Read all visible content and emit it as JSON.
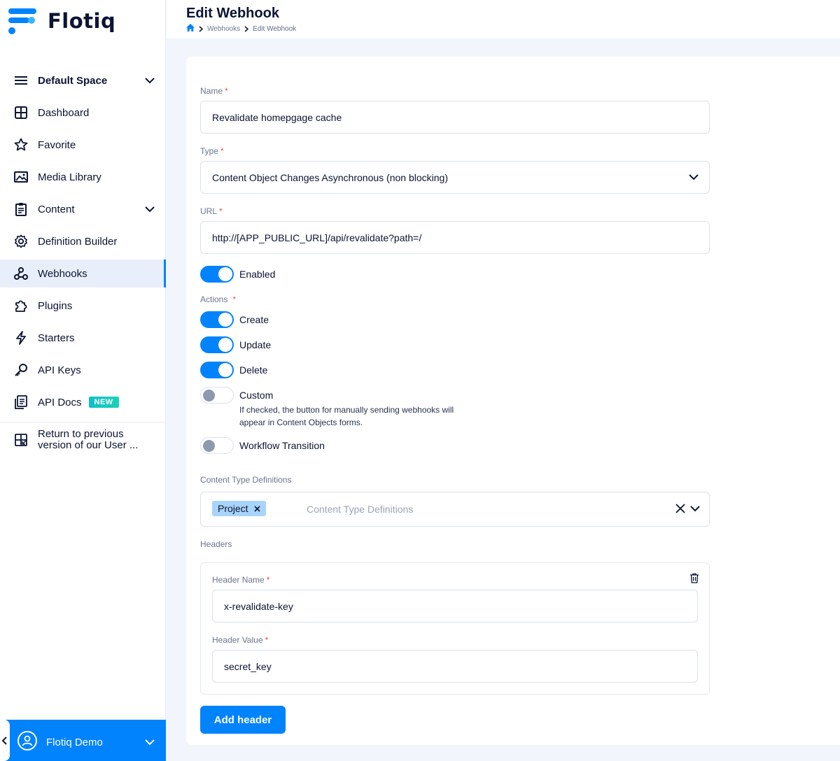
{
  "app": {
    "name": "Flotiq"
  },
  "sidebar": {
    "space": "Default Space",
    "items": [
      {
        "label": "Dashboard"
      },
      {
        "label": "Favorite"
      },
      {
        "label": "Media Library"
      },
      {
        "label": "Content"
      },
      {
        "label": "Definition Builder"
      },
      {
        "label": "Webhooks"
      },
      {
        "label": "Plugins"
      },
      {
        "label": "Starters"
      },
      {
        "label": "API Keys"
      },
      {
        "label": "API Docs",
        "badge": "NEW"
      }
    ],
    "return_label": "Return to previous version of our User ...",
    "user": "Flotiq Demo"
  },
  "header": {
    "title": "Edit Webhook",
    "breadcrumb": [
      "Webhooks",
      "Edit Webhook"
    ]
  },
  "form": {
    "name_label": "Name",
    "name_value": "Revalidate homepgage cache",
    "type_label": "Type",
    "type_value": "Content Object Changes Asynchronous (non blocking)",
    "url_label": "URL",
    "url_value": "http://[APP_PUBLIC_URL]/api/revalidate?path=/",
    "enabled_label": "Enabled",
    "enabled": true,
    "actions_label": "Actions",
    "actions": {
      "create": {
        "label": "Create",
        "on": true
      },
      "update": {
        "label": "Update",
        "on": true
      },
      "delete": {
        "label": "Delete",
        "on": true
      },
      "custom": {
        "label": "Custom",
        "on": false,
        "help": "If checked, the button for manually sending webhooks will appear in Content Objects forms."
      },
      "workflow": {
        "label": "Workflow Transition",
        "on": false
      }
    },
    "ctd_label": "Content Type Definitions",
    "ctd_chip": "Project",
    "ctd_placeholder": "Content Type Definitions",
    "headers_label": "Headers",
    "header_name_label": "Header Name",
    "header_name_value": "x-revalidate-key",
    "header_value_label": "Header Value",
    "header_value_value": "secret_key",
    "add_header": "Add header",
    "required_mark": "*"
  },
  "colors": {
    "accent": "#0083fc",
    "text": "#0b1433",
    "required": "#e8533b"
  }
}
